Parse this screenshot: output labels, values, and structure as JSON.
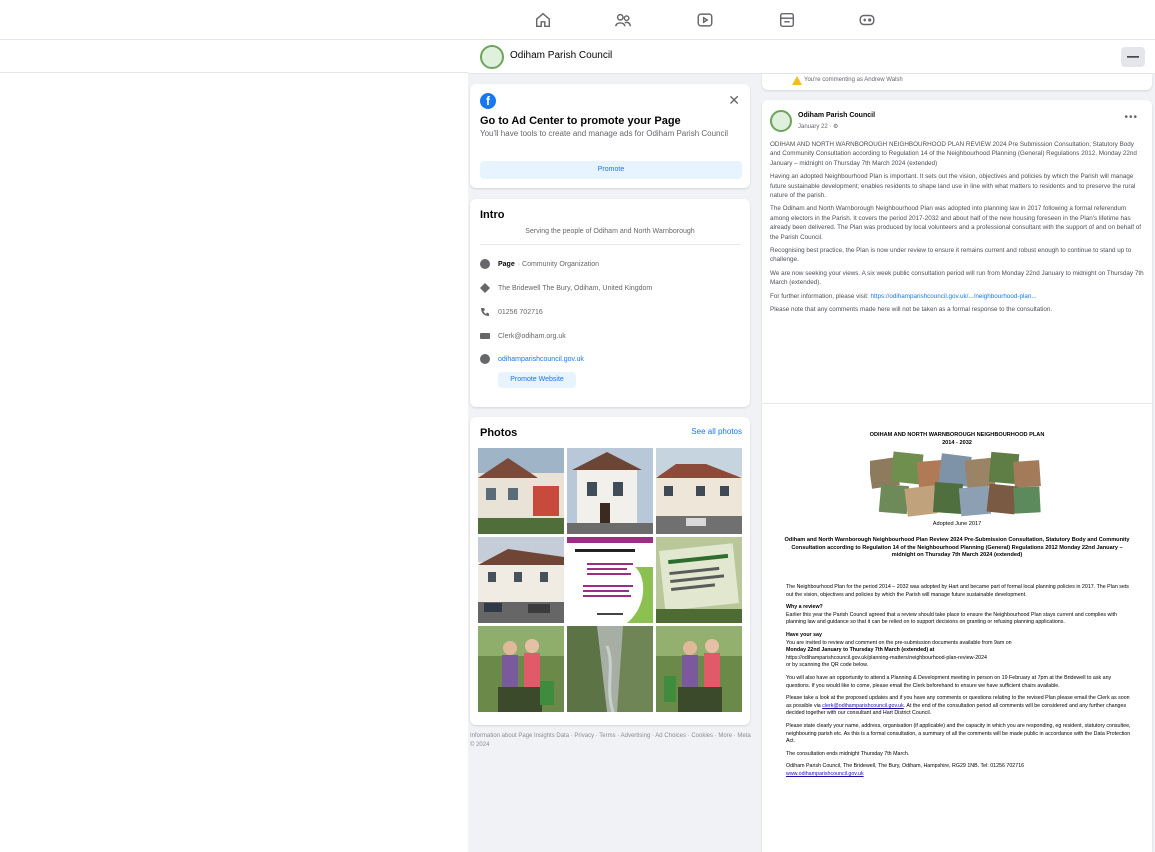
{
  "colors": {
    "accent": "#1877f2",
    "background": "#f0f2f5",
    "card": "#ffffff",
    "muted_text": "#65676b",
    "warning": "#f7b928"
  },
  "nav": {
    "icons": [
      "home-icon",
      "friends-icon",
      "watch-icon",
      "marketplace-icon",
      "gaming-icon"
    ]
  },
  "page_header": {
    "title": "Odiham Parish Council",
    "more_label": "—"
  },
  "comment_notice": "You're commenting as Andrew Walsh",
  "ad_center": {
    "title": "Go to Ad Center to promote your Page",
    "description": "You'll have tools to create and manage ads for Odiham Parish Council",
    "button_label": "Promote",
    "close_label": "✕"
  },
  "intro": {
    "heading": "Intro",
    "bio": "Serving the people of Odiham and North Warnborough",
    "page_label": "Page",
    "page_category": "· Community Organization",
    "address": "The Bridewell The Bury, Odiham, United Kingdom",
    "phone": "01256 702716",
    "email": "Clerk@odiham.org.uk",
    "website": "odihamparishcouncil.gov.uk",
    "website_button": "Promote Website"
  },
  "photos": {
    "heading": "Photos",
    "see_all_label": "See all photos"
  },
  "footer_links": "Information about Page Insights Data · Privacy · Terms · Advertising · Ad Choices · Cookies · More · Meta © 2024",
  "post": {
    "author": "Odiham Parish Council",
    "meta": "January 22 · ⚙",
    "more_label": "•••",
    "paragraphs": [
      "ODIHAM AND NORTH WARNBOROUGH NEIGHBOURHOOD PLAN REVIEW 2024 Pre Submission Consultation, Statutory Body and Community Consultation according to Regulation 14 of the Neighbourhood Planning (General) Regulations 2012. Monday 22nd January – midnight on Thursday 7th March 2024 (extended)",
      "Having an adopted Neighbourhood Plan is important. It sets out the vision, objectives and policies by which the Parish will manage future sustainable development; enables residents to shape land use in line with what matters to residents and to preserve the rural nature of the parish.",
      "The Odiham and North Warnborough Neighbourhood Plan was adopted into planning law in 2017 following a formal referendum among electors in the Parish. It covers the period 2017-2032 and about half of the new housing foreseen in the Plan's lifetime has already been delivered. The Plan was produced by local volunteers and a professional consultant with the support of and on behalf of the Parish Council.",
      "Recognising best practice, the Plan is now under review to ensure it remains current and robust enough to continue to stand up to challenge.",
      "We are now seeking your views. A six week public consultation period will run from Monday 22nd January to midnight on Thursday 7th March (extended).",
      "Please note that any comments made here will not be taken as a formal response to the consultation."
    ],
    "further_info_prefix": "For further information, please visit:",
    "further_info_link": "https://odihamparishcouncil.gov.uk/.../neighbourhood-plan..."
  },
  "document": {
    "title_line1": "ODIHAM AND NORTH WARNBOROUGH NEIGHBOURHOOD PLAN",
    "title_line2": "2014 - 2032",
    "adopted": "Adopted June 2017",
    "heading": "Odiham and North Warnborough Neighbourhood Plan Review 2024 Pre-Submission Consultation, Statutory Body and Community Consultation according to Regulation 14 of the Neighbourhood Planning (General) Regulations 2012 Monday 22nd January – midnight on Thursday 7th March 2024 (extended)",
    "intro": "The Neighbourhood Plan for the period 2014 – 2032 was adopted by Hart and became part of formal local planning policies in 2017. The Plan sets out the vision, objectives and policies by which the Parish will manage future sustainable development.",
    "why_heading": "Why a review?",
    "why_text": "Earlier this year the Parish Council agreed that a review should take place to ensure the Neighbourhood Plan stays current and complies with planning law and guidance so that it can be relied on to support decisions on granting or refusing planning applications.",
    "say_heading": "Have your say",
    "say_text": "You are invited to review and comment on the pre-submission documents available from 9am on",
    "say_dates": "Monday 22nd January to Thursday 7th March (extended) at",
    "say_url": "https://odihamparishcouncil.gov.uk/planning-matters/neighbourhood-plan-review-2024",
    "say_qr": "or by scanning the QR code below.",
    "meeting_text": "You will also have an opportunity to attend a Planning & Development meeting in person on 19 February at 7pm at the Bridewell to ask any questions. If you would like to come, please email the Clerk beforehand to ensure we have sufficient chairs available.",
    "comments_text_pre": "Please take a look at the proposed updates and if you have any comments or questions relating to the revised Plan please email the Clerk as soon as possible via",
    "comments_email": "clerk@odihamparishcouncil.gov.uk",
    "comments_text_post": ". At the end of the consultation period all comments will be considered and any further changes decided together with our consultant and Hart District Council.",
    "privacy_text": "Please state clearly your name, address, organisation (if applicable) and the capacity in which you are responding, eg resident, statutory consultee, neighbouring parish etc. As this is a formal consultation, a summary of all the comments will be made public in accordance with the Data Protection Act.",
    "close_text": "The consultation ends midnight Thursday 7th March.",
    "address_text": "Odiham Parish Council, The Bridewell, The Bury, Odiham, Hampshire, RG29 1NB. Tel: 01256 702716",
    "address_link": "www.odihamparishcouncil.gov.uk"
  }
}
